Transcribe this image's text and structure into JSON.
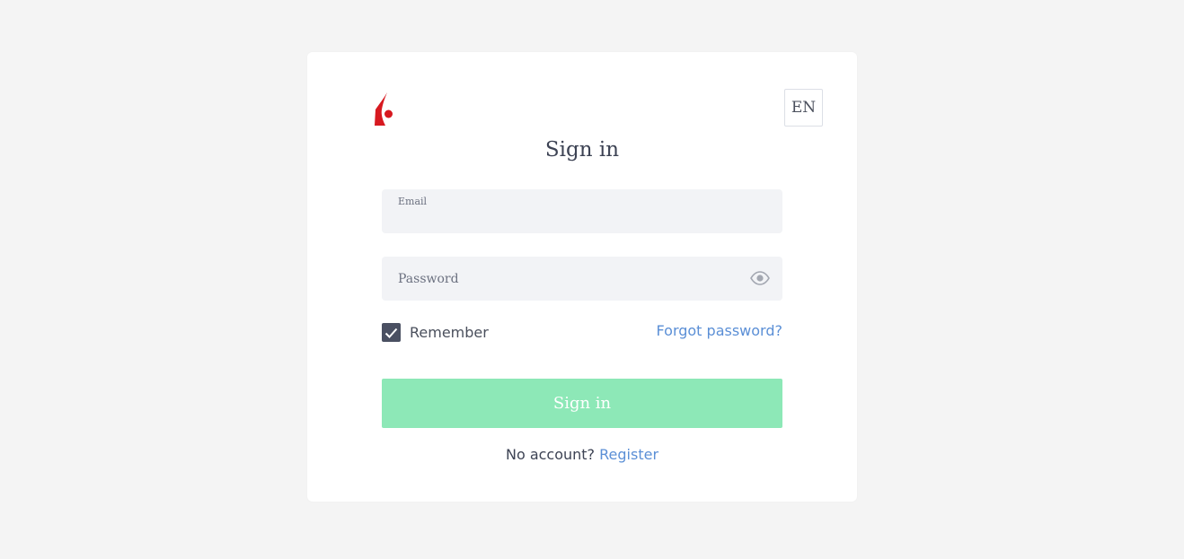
{
  "header": {
    "title": "Sign in",
    "language": "EN"
  },
  "form": {
    "email_label": "Email",
    "email_value": "",
    "password_placeholder": "Password",
    "password_value": "",
    "remember_label": "Remember",
    "remember_checked": true,
    "forgot_link": "Forgot password?",
    "submit_label": "Sign in"
  },
  "footer": {
    "prompt": "No account?",
    "register_link": "Register"
  },
  "icons": {
    "logo": "brand-logo",
    "password_toggle": "eye-icon",
    "checkbox": "checkmark-icon"
  },
  "colors": {
    "background": "#f4f4f4",
    "card": "#ffffff",
    "field": "#f2f3f6",
    "accent_link": "#5b8fd6",
    "button": "#8de8b7",
    "checkbox": "#4a5062",
    "logo": "#d71920"
  }
}
